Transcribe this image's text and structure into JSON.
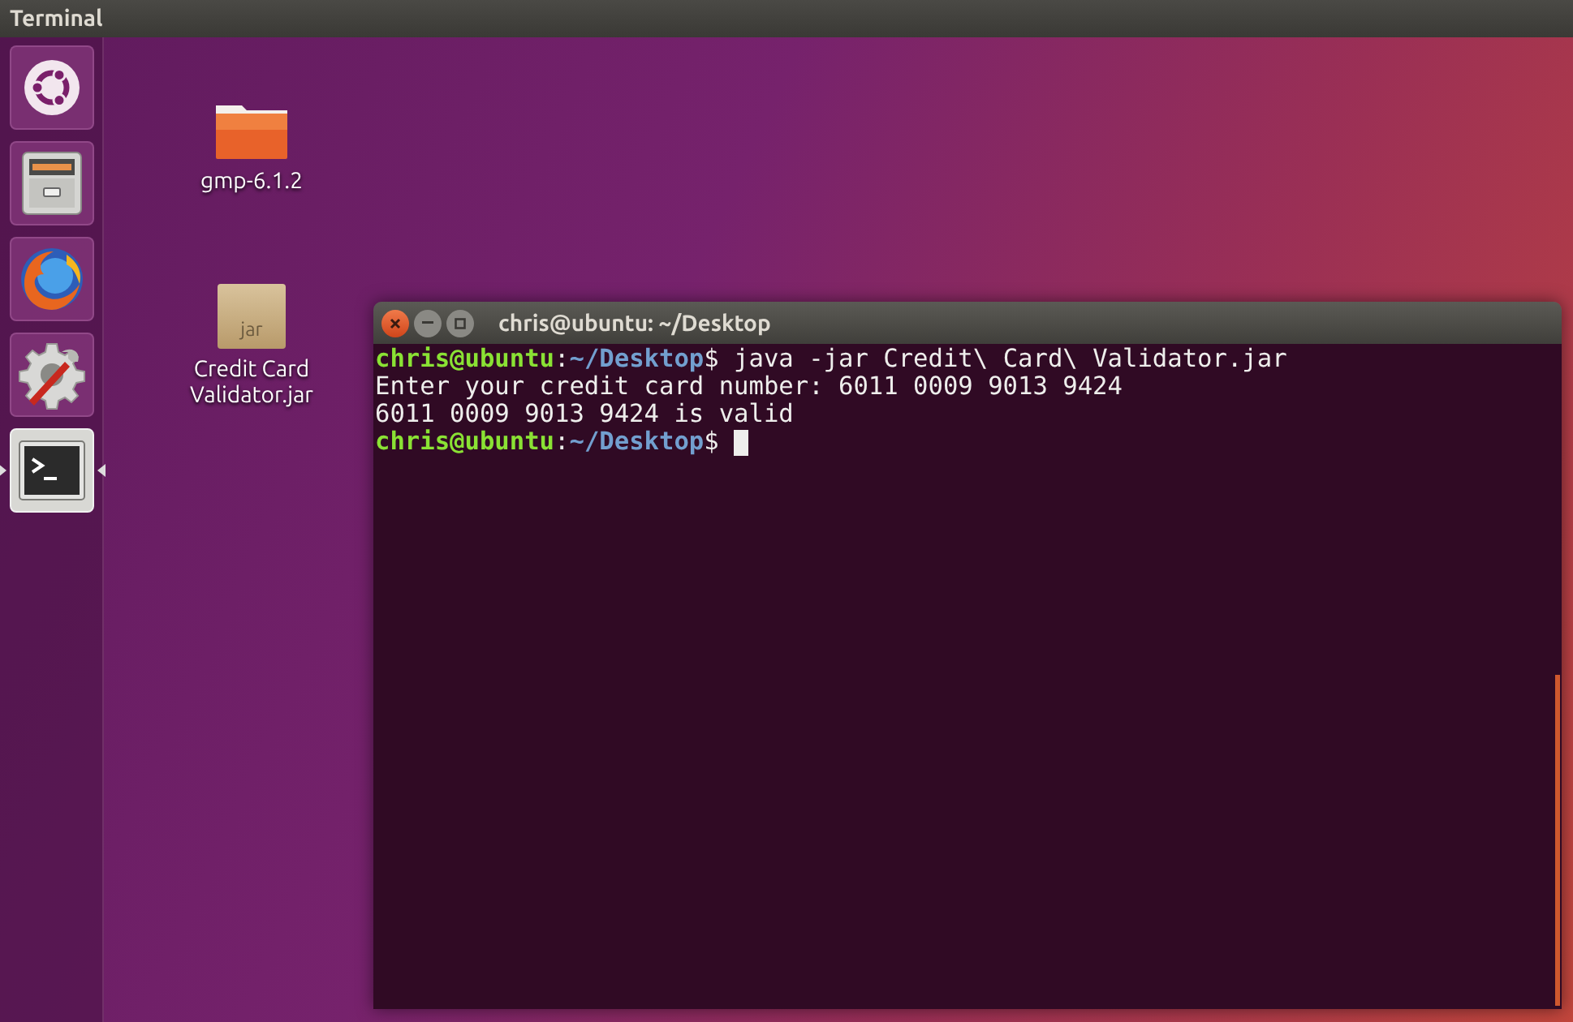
{
  "top_bar": {
    "title": "Terminal"
  },
  "launcher": {
    "items": [
      {
        "kind": "dash",
        "selected": false
      },
      {
        "kind": "files",
        "selected": false
      },
      {
        "kind": "browser",
        "selected": false
      },
      {
        "kind": "settings",
        "selected": false
      },
      {
        "kind": "terminal",
        "selected": true
      }
    ]
  },
  "desktop_icons": [
    {
      "kind": "folder",
      "label": "gmp-6.1.2"
    },
    {
      "kind": "jar",
      "badge": "jar",
      "label": "Credit Card Validator.jar"
    }
  ],
  "terminal_window": {
    "title": "chris@ubuntu: ~/Desktop",
    "lines": [
      {
        "segments": [
          {
            "kind": "user",
            "text": "chris@ubuntu"
          },
          {
            "kind": "plain",
            "text": ":"
          },
          {
            "kind": "path",
            "text": "~/Desktop"
          },
          {
            "kind": "plain",
            "text": "$ java -jar Credit\\ Card\\ Validator.jar"
          }
        ]
      },
      {
        "segments": [
          {
            "kind": "plain",
            "text": "Enter your credit card number: 6011 0009 9013 9424"
          }
        ]
      },
      {
        "segments": [
          {
            "kind": "plain",
            "text": "6011 0009 9013 9424 is valid"
          }
        ]
      },
      {
        "segments": [
          {
            "kind": "user",
            "text": "chris@ubuntu"
          },
          {
            "kind": "plain",
            "text": ":"
          },
          {
            "kind": "path",
            "text": "~/Desktop"
          },
          {
            "kind": "plain",
            "text": "$ "
          }
        ],
        "cursor": true
      }
    ]
  }
}
